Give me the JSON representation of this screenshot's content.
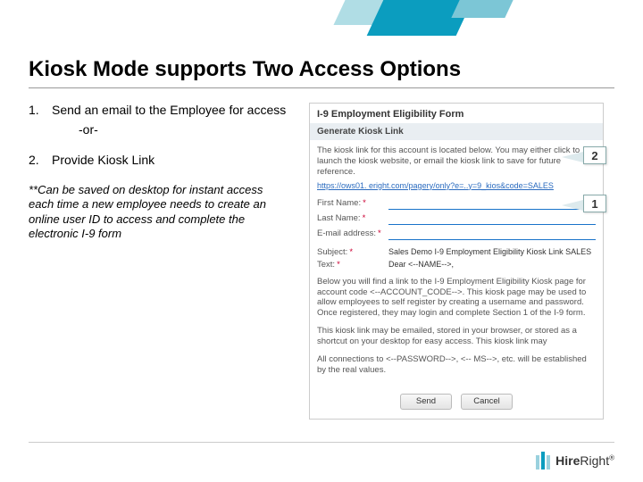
{
  "title": "Kiosk Mode supports Two Access Options",
  "list": {
    "n1": "1.",
    "item1": "Send an email to the Employee for access",
    "or": "-or-",
    "n2": "2.",
    "item2": "Provide Kiosk Link"
  },
  "note": "**Can be saved on desktop for instant access each time a new employee needs to create an online user ID to access and complete the electronic I-9 form",
  "panel": {
    "header": "I-9 Employment Eligibility Form",
    "section": "Generate Kiosk Link",
    "intro": "The kiosk link for this account is located below. You may either click to launch the kiosk website, or email the kiosk link to save for future reference.",
    "link": "https://ows01.    eright.com/pagery/only?e=..y=9_kios&code=SALES",
    "labels": {
      "first": "First Name:",
      "last": "Last Name:",
      "email": "E-mail address:",
      "subject": "Subject:",
      "text": "Text:"
    },
    "required": "*",
    "subject_value": "Sales Demo I-9 Employment Eligibility Kiosk Link SALES",
    "text_value": "Dear <--NAME-->,",
    "para1": "Below you will find a link to the I-9 Employment Eligibility Kiosk page for account code <--ACCOUNT_CODE-->. This kiosk page may be used to allow employees to self register by creating a username and password.  Once registered, they may login and complete Section 1 of the I-9 form.",
    "para2": "This kiosk link may be emailed, stored in your browser, or stored as a shortcut on your desktop for easy access. This kiosk link may",
    "para3": "All connections to <--PASSWORD-->, <-- MS-->, etc. will be established by the real values.",
    "buttons": {
      "send": "Send",
      "cancel": "Cancel"
    }
  },
  "callouts": {
    "c1": "1",
    "c2": "2"
  },
  "footer": {
    "brand1": "Hire",
    "brand2": "Right",
    "mark": "®"
  }
}
